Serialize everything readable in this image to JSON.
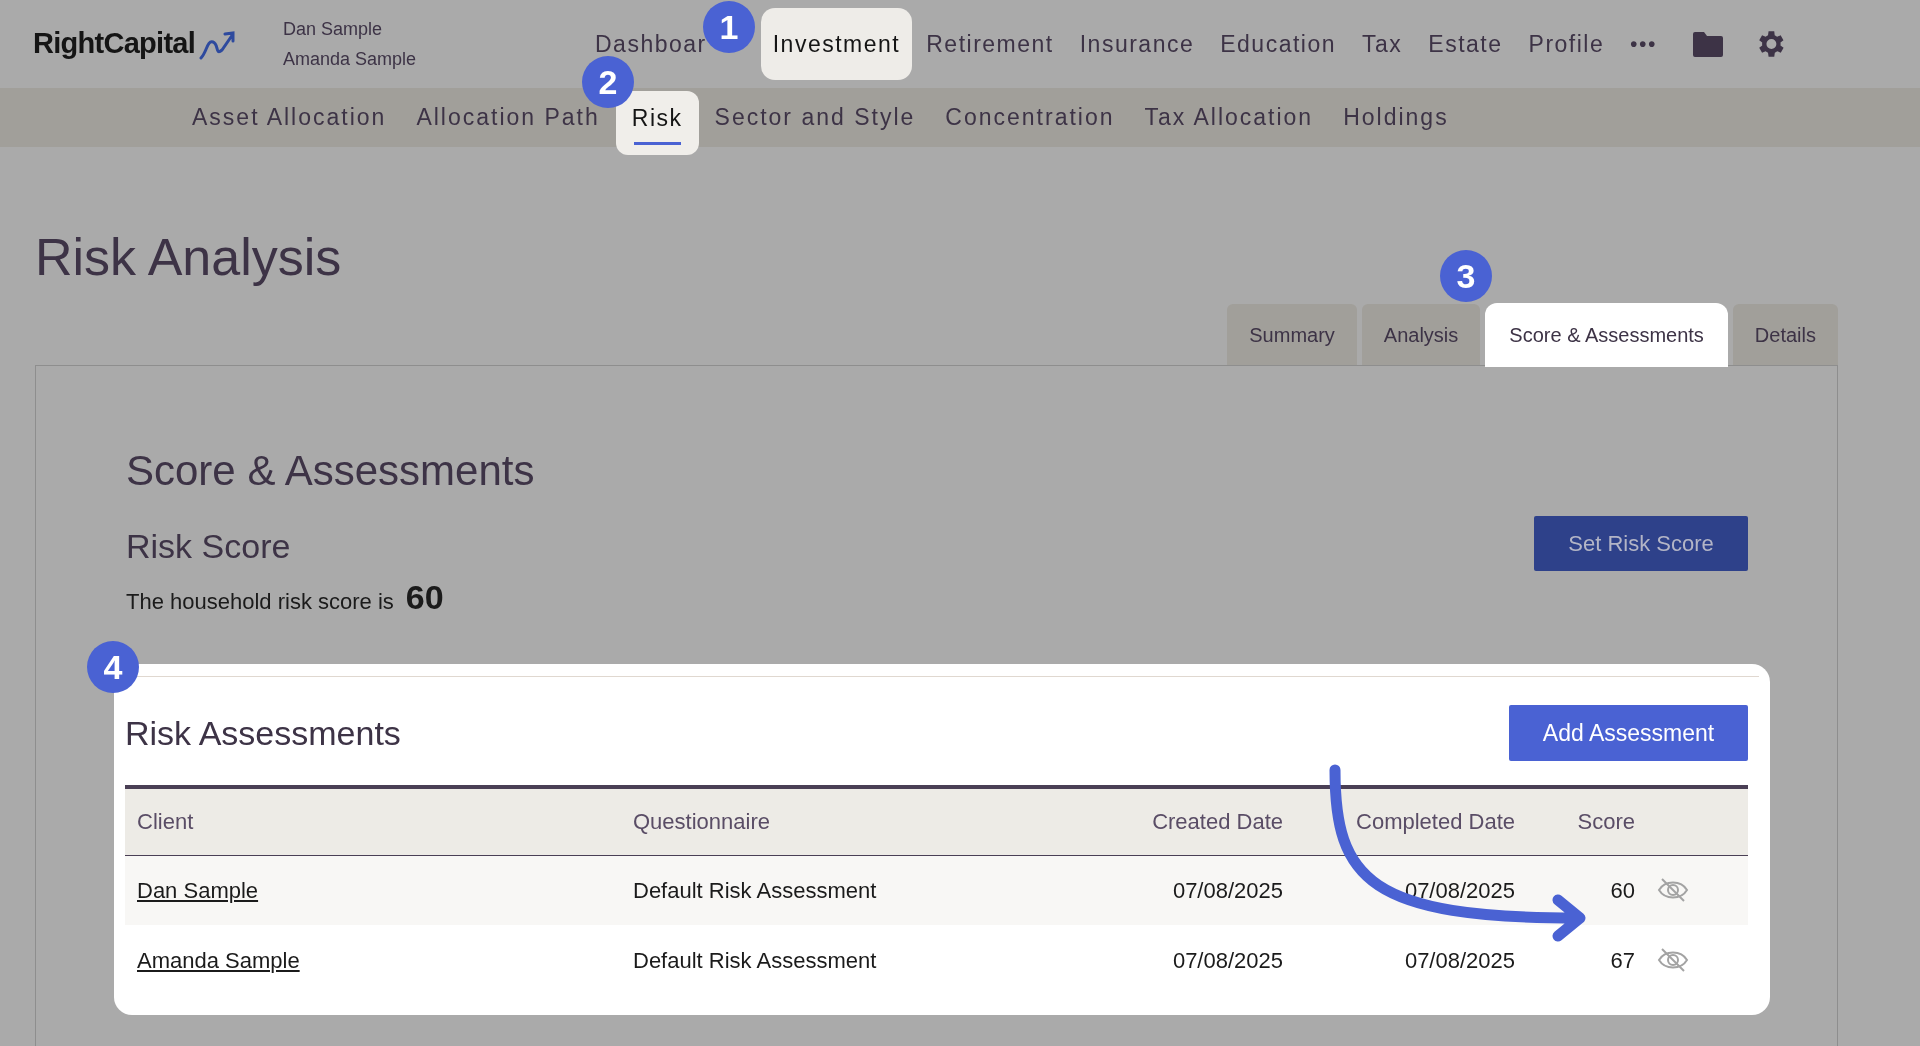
{
  "logo": "RightCapital",
  "users": [
    "Dan Sample",
    "Amanda Sample"
  ],
  "nav": [
    {
      "label": "Dashboar",
      "selected": false
    },
    {
      "label": "Investment",
      "selected": true
    },
    {
      "label": "Retirement",
      "selected": false
    },
    {
      "label": "Insurance",
      "selected": false
    },
    {
      "label": "Education",
      "selected": false
    },
    {
      "label": "Tax",
      "selected": false
    },
    {
      "label": "Estate",
      "selected": false
    },
    {
      "label": "Profile",
      "selected": false
    }
  ],
  "more": "•••",
  "sub_nav": [
    {
      "label": "Asset Allocation",
      "selected": false
    },
    {
      "label": "Allocation Path",
      "selected": false
    },
    {
      "label": "Risk",
      "selected": true
    },
    {
      "label": "Sector and Style",
      "selected": false
    },
    {
      "label": "Concentration",
      "selected": false
    },
    {
      "label": "Tax Allocation",
      "selected": false
    },
    {
      "label": "Holdings",
      "selected": false
    }
  ],
  "page_title": "Risk Analysis",
  "tabs": [
    {
      "label": "Summary",
      "selected": false
    },
    {
      "label": "Analysis",
      "selected": false
    },
    {
      "label": "Score & Assessments",
      "selected": true
    },
    {
      "label": "Details",
      "selected": false
    }
  ],
  "section_title": "Score & Assessments",
  "risk_score": {
    "heading": "Risk Score",
    "sentence": "The household risk score is",
    "value": "60",
    "button": "Set Risk Score"
  },
  "assessments": {
    "title": "Risk Assessments",
    "button": "Add Assessment",
    "columns": [
      "Client",
      "Questionnaire",
      "Created Date",
      "Completed Date",
      "Score"
    ],
    "rows": [
      {
        "client": "Dan Sample",
        "questionnaire": "Default Risk Assessment",
        "created": "07/08/2025",
        "completed": "07/08/2025",
        "score": "60"
      },
      {
        "client": "Amanda Sample",
        "questionnaire": "Default Risk Assessment",
        "created": "07/08/2025",
        "completed": "07/08/2025",
        "score": "67"
      }
    ]
  },
  "callouts": [
    "1",
    "2",
    "3",
    "4"
  ]
}
